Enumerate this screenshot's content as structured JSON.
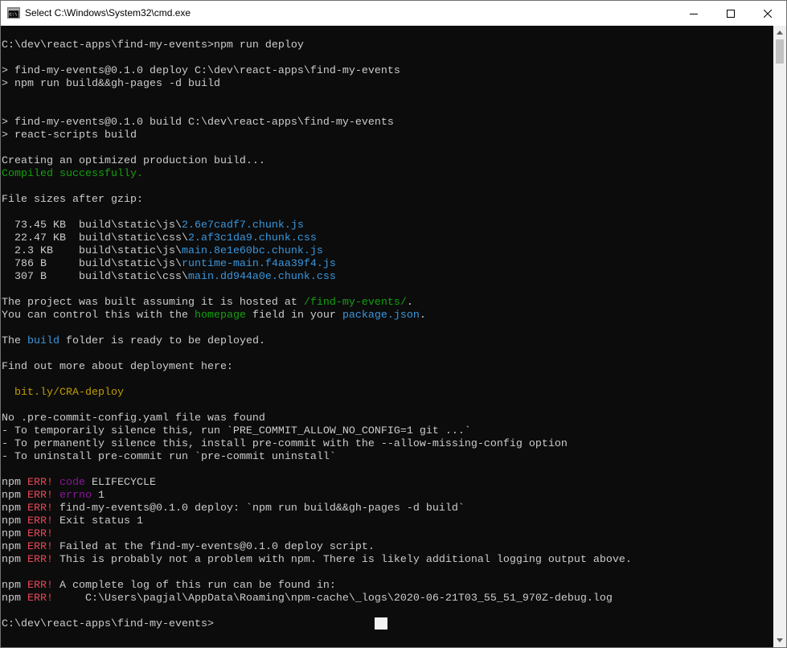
{
  "window": {
    "title": "Select C:\\Windows\\System32\\cmd.exe",
    "icon": "cmd-app-icon",
    "controls": [
      "minimize-icon",
      "maximize-icon",
      "close-icon"
    ]
  },
  "console": {
    "colors": {
      "background": "#0c0c0c",
      "text": "#cccccc",
      "green": "#13a10e",
      "blue": "#3b78ff",
      "cyan": "#3a96dd",
      "yellow": "#c19c00",
      "red": "#e74856",
      "magenta": "#881798"
    },
    "lines": [
      [
        {
          "t": "C:\\dev\\react-apps\\find-my-events>npm run deploy"
        }
      ],
      [],
      [
        {
          "t": "> find-my-events@0.1.0 deploy C:\\dev\\react-apps\\find-my-events"
        }
      ],
      [
        {
          "t": "> npm run build&&gh-pages -d build"
        }
      ],
      [],
      [],
      [
        {
          "t": "> find-my-events@0.1.0 build C:\\dev\\react-apps\\find-my-events"
        }
      ],
      [
        {
          "t": "> react-scripts build"
        }
      ],
      [],
      [
        {
          "t": "Creating an optimized production build..."
        }
      ],
      [
        {
          "t": "Compiled successfully.",
          "c": "green"
        }
      ],
      [],
      [
        {
          "t": "File sizes after gzip:"
        }
      ],
      [],
      [
        {
          "t": "  73.45 KB  build\\static\\js\\"
        },
        {
          "t": "2.6e7cadf7.chunk.js",
          "c": "cyan"
        }
      ],
      [
        {
          "t": "  22.47 KB  build\\static\\css\\"
        },
        {
          "t": "2.af3c1da9.chunk.css",
          "c": "cyan"
        }
      ],
      [
        {
          "t": "  2.3 KB    build\\static\\js\\"
        },
        {
          "t": "main.8e1e60bc.chunk.js",
          "c": "cyan"
        }
      ],
      [
        {
          "t": "  786 B     build\\static\\js\\"
        },
        {
          "t": "runtime-main.f4aa39f4.js",
          "c": "cyan"
        }
      ],
      [
        {
          "t": "  307 B     build\\static\\css\\"
        },
        {
          "t": "main.dd944a0e.chunk.css",
          "c": "cyan"
        }
      ],
      [],
      [
        {
          "t": "The project was built assuming it is hosted at "
        },
        {
          "t": "/find-my-events/",
          "c": "green"
        },
        {
          "t": "."
        }
      ],
      [
        {
          "t": "You can control this with the "
        },
        {
          "t": "homepage",
          "c": "green"
        },
        {
          "t": " field in your "
        },
        {
          "t": "package.json",
          "c": "cyan"
        },
        {
          "t": "."
        }
      ],
      [],
      [
        {
          "t": "The "
        },
        {
          "t": "build",
          "c": "cyan"
        },
        {
          "t": " folder is ready to be deployed."
        }
      ],
      [],
      [
        {
          "t": "Find out more about deployment here:"
        }
      ],
      [],
      [
        {
          "t": "  "
        },
        {
          "t": "bit.ly/CRA-deploy",
          "c": "yellow"
        }
      ],
      [],
      [
        {
          "t": "No .pre-commit-config.yaml file was found"
        }
      ],
      [
        {
          "t": "- To temporarily silence this, run `PRE_COMMIT_ALLOW_NO_CONFIG=1 git ...`"
        }
      ],
      [
        {
          "t": "- To permanently silence this, install pre-commit with the --allow-missing-config option"
        }
      ],
      [
        {
          "t": "- To uninstall pre-commit run `pre-commit uninstall`"
        }
      ],
      [],
      [
        {
          "t": "npm "
        },
        {
          "t": "ERR!",
          "c": "red"
        },
        {
          "t": " "
        },
        {
          "t": "code",
          "c": "magenta"
        },
        {
          "t": " ELIFECYCLE"
        }
      ],
      [
        {
          "t": "npm "
        },
        {
          "t": "ERR!",
          "c": "red"
        },
        {
          "t": " "
        },
        {
          "t": "errno",
          "c": "magenta"
        },
        {
          "t": " 1"
        }
      ],
      [
        {
          "t": "npm "
        },
        {
          "t": "ERR!",
          "c": "red"
        },
        {
          "t": " find-my-events@0.1.0 deploy: `npm run build&&gh-pages -d build`"
        }
      ],
      [
        {
          "t": "npm "
        },
        {
          "t": "ERR!",
          "c": "red"
        },
        {
          "t": " Exit status 1"
        }
      ],
      [
        {
          "t": "npm "
        },
        {
          "t": "ERR!",
          "c": "red"
        }
      ],
      [
        {
          "t": "npm "
        },
        {
          "t": "ERR!",
          "c": "red"
        },
        {
          "t": " Failed at the find-my-events@0.1.0 deploy script."
        }
      ],
      [
        {
          "t": "npm "
        },
        {
          "t": "ERR!",
          "c": "red"
        },
        {
          "t": " This is probably not a problem with npm. There is likely additional logging output above."
        }
      ],
      [],
      [
        {
          "t": "npm "
        },
        {
          "t": "ERR!",
          "c": "red"
        },
        {
          "t": " A complete log of this run can be found in:"
        }
      ],
      [
        {
          "t": "npm "
        },
        {
          "t": "ERR!",
          "c": "red"
        },
        {
          "t": "     C:\\Users\\pagjal\\AppData\\Roaming\\npm-cache\\_logs\\2020-06-21T03_55_51_970Z-debug.log"
        }
      ],
      [],
      [
        {
          "t": "C:\\dev\\react-apps\\find-my-events>"
        }
      ]
    ]
  }
}
